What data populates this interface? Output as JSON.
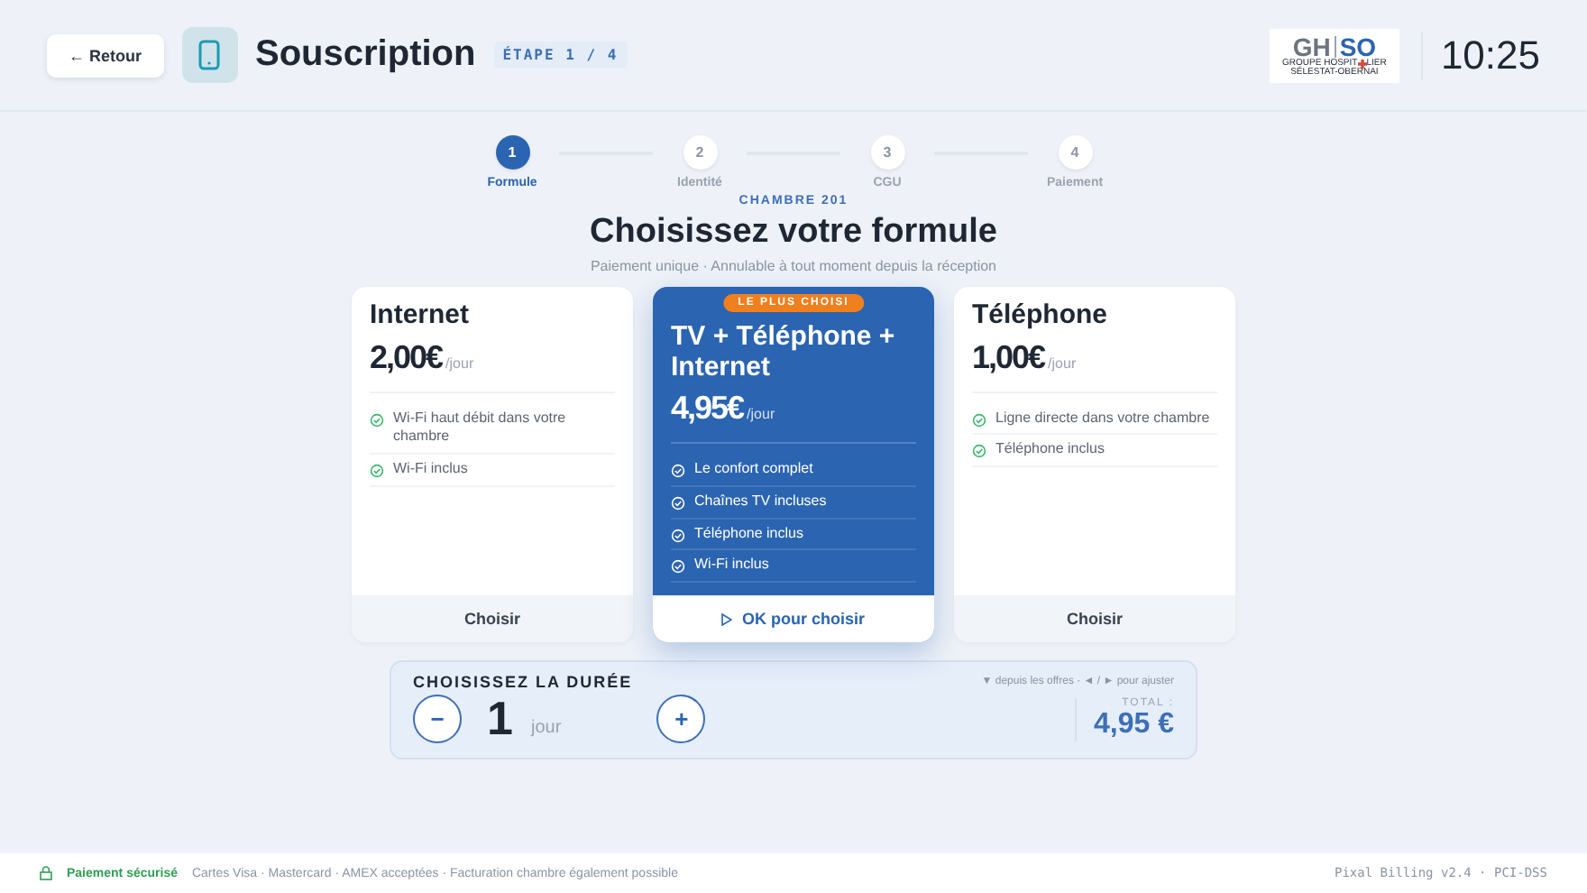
{
  "header": {
    "back_button": "← Retour",
    "title": "Souscription",
    "step_badge": "ÉTAPE 1 / 4",
    "logo": {
      "gh": "GH",
      "so": "SO",
      "line1_start": "GROUPE HOSPIT",
      "line1_end": "LIER",
      "line2": "SÉLESTAT-OBERNAI"
    },
    "clock": "10:25"
  },
  "steps": [
    {
      "number": "1",
      "label": "Formule",
      "selected": true
    },
    {
      "number": "2",
      "label": "Identité",
      "selected": false
    },
    {
      "number": "3",
      "label": "CGU",
      "selected": false
    },
    {
      "number": "4",
      "label": "Paiement",
      "selected": false
    }
  ],
  "room": "CHAMBRE 201",
  "heading": "Choisissez votre formule",
  "subheading": "Paiement unique · Annulable à tout moment depuis la réception",
  "plans": [
    {
      "name": "Internet",
      "price": "2,00€",
      "unit": "/jour",
      "features": [
        "Wi-Fi haut débit dans votre chambre",
        "Wi-Fi inclus"
      ],
      "cta": "Choisir",
      "selected": false
    },
    {
      "name": "TV + Téléphone + Internet",
      "price": "4,95€",
      "unit": "/jour",
      "badge": "LE PLUS CHOISI",
      "features": [
        "Le confort complet",
        "Chaînes TV incluses",
        "Téléphone inclus",
        "Wi-Fi inclus"
      ],
      "cta": "OK pour choisir",
      "selected": true
    },
    {
      "name": "Téléphone",
      "price": "1,00€",
      "unit": "/jour",
      "features": [
        "Ligne directe dans votre chambre",
        "Téléphone inclus"
      ],
      "cta": "Choisir",
      "selected": false
    }
  ],
  "duration": {
    "title": "CHOISISSEZ LA DURÉE",
    "hint": "▼ depuis les offres · ◄ / ► pour ajuster",
    "minus": "−",
    "plus": "+",
    "value": "1",
    "unit": "jour",
    "total_label": "TOTAL :",
    "total": "4,95 €"
  },
  "footer": {
    "secure": "Paiement sécurisé",
    "cards": "Cartes Visa · Mastercard · AMEX acceptées · Facturation chambre également possible",
    "version": "Pixal Billing v2.4 · PCI-DSS"
  }
}
